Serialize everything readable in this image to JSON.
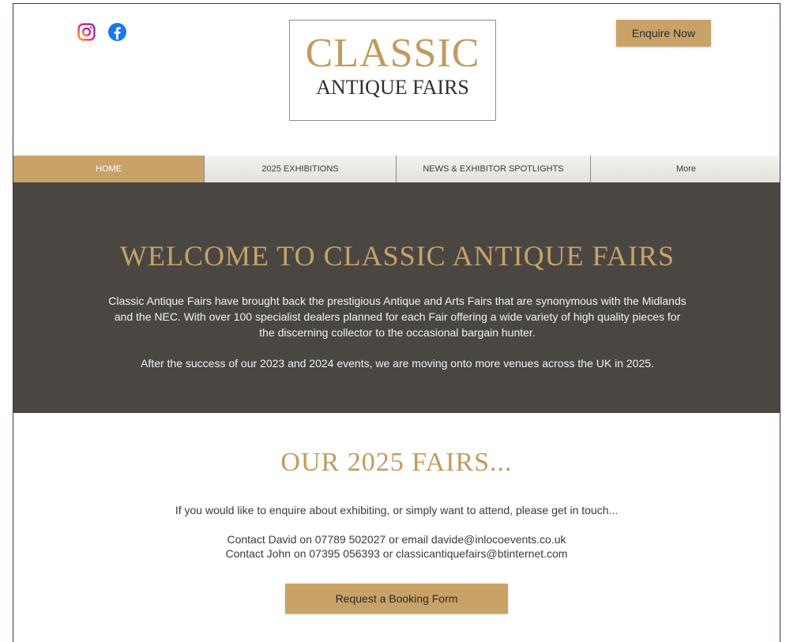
{
  "header": {
    "logo_line1": "CLASSIC",
    "logo_line2": "ANTIQUE FAIRS",
    "enquire_label": "Enquire Now",
    "social": [
      {
        "icon": "instagram-icon"
      },
      {
        "icon": "facebook-icon"
      }
    ]
  },
  "nav": {
    "items": [
      {
        "label": "HOME",
        "active": true
      },
      {
        "label": "2025 EXHIBITIONS",
        "active": false
      },
      {
        "label": "NEWS & EXHIBITOR SPOTLIGHTS",
        "active": false
      },
      {
        "label": "More",
        "active": false
      }
    ]
  },
  "hero": {
    "title": "WELCOME TO CLASSIC ANTIQUE FAIRS",
    "paragraph1": "Classic Antique Fairs have brought back the prestigious Antique and Arts Fairs that are synonymous with the Midlands and the NEC. With over 100 specialist dealers planned for each Fair offering a wide variety of high quality pieces for the discerning collector to the occasional bargain hunter.",
    "paragraph2": "After the success of our 2023 and 2024 events, we are moving onto more venues across the UK in 2025."
  },
  "fairs": {
    "title": "OUR 2025 FAIRS...",
    "intro": "If you would like to enquire about exhibiting, or simply want to attend, please get in touch...",
    "contact1": "Contact David on 07789 502027 or email davide@inlocoevents.co.uk",
    "contact2": "Contact John on 07395 056393 or classicantiquefairs@btinternet.com",
    "booking_label": "Request a Booking Form"
  },
  "colors": {
    "gold": "#c9a268",
    "hero_bg": "#4a4743",
    "nav_bg": "#ebe9e3"
  }
}
